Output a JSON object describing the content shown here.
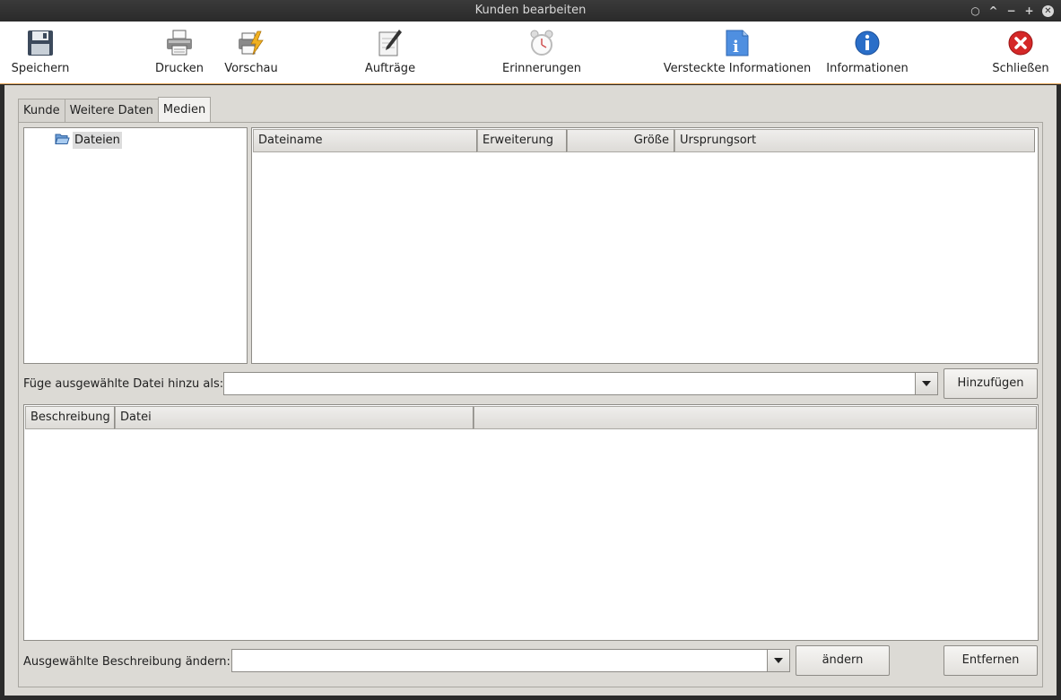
{
  "window": {
    "title": "Kunden bearbeiten"
  },
  "toolbar": {
    "items": [
      {
        "label": "Speichern",
        "icon": "floppy-disk-icon"
      },
      {
        "label": "Drucken",
        "icon": "printer-icon"
      },
      {
        "label": "Vorschau",
        "icon": "print-preview-icon"
      },
      {
        "label": "Aufträge",
        "icon": "notepad-pencil-icon"
      },
      {
        "label": "Erinnerungen",
        "icon": "alarm-clock-icon"
      },
      {
        "label": "Versteckte Informationen",
        "icon": "info-document-icon"
      },
      {
        "label": "Informationen",
        "icon": "info-circle-icon"
      },
      {
        "label": "Schließen",
        "icon": "close-red-icon"
      }
    ]
  },
  "tabs": [
    {
      "label": "Kunde",
      "active": false
    },
    {
      "label": "Weitere Daten",
      "active": false
    },
    {
      "label": "Medien",
      "active": true
    }
  ],
  "tree": {
    "root_label": "Dateien",
    "icon": "folder-open-icon"
  },
  "files_table": {
    "columns": [
      "Dateiname",
      "Erweiterung",
      "Größe",
      "Ursprungsort"
    ],
    "rows": []
  },
  "add_row": {
    "label": "Füge ausgewählte Datei hinzu als:",
    "value": "",
    "button": "Hinzufügen"
  },
  "desc_table": {
    "columns": [
      "Beschreibung",
      "Datei",
      ""
    ],
    "rows": []
  },
  "change_row": {
    "label": "Ausgewählte Beschreibung ändern:",
    "value": "",
    "change_button": "ändern",
    "remove_button": "Entfernen"
  },
  "colors": {
    "toolbar_border": "#e0a050",
    "window_bg": "#dcdad5",
    "titlebar_bg": "#2f2f2f"
  }
}
